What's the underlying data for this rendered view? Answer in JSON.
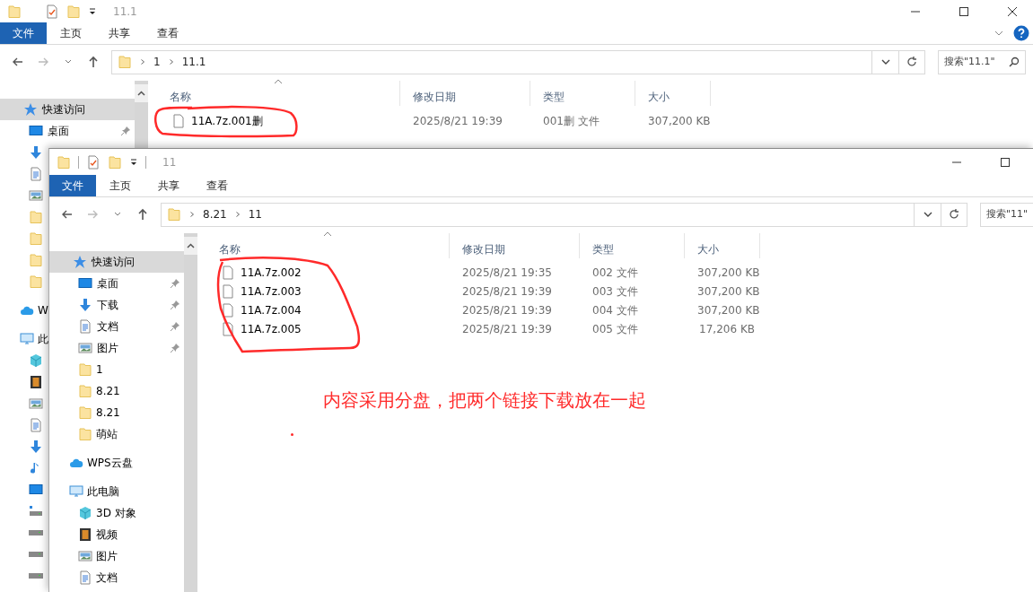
{
  "back_window": {
    "title": "11.1",
    "ribbon_tabs": [
      {
        "label": "文件",
        "selected": true
      },
      {
        "label": "主页",
        "selected": false
      },
      {
        "label": "共享",
        "selected": false
      },
      {
        "label": "查看",
        "selected": false
      }
    ],
    "breadcrumb": [
      "1",
      "11.1"
    ],
    "search": {
      "placeholder": "搜索\"11.1\""
    },
    "nav": [
      {
        "kind": "star",
        "label": "快速访问",
        "selected": true,
        "children": [
          {
            "kind": "desktop",
            "label": "桌面",
            "pinned": true
          },
          {
            "kind": "download"
          },
          {
            "kind": "doc"
          },
          {
            "kind": "picture"
          },
          {
            "kind": "folder"
          },
          {
            "kind": "folder"
          },
          {
            "kind": "folder"
          },
          {
            "kind": "folder"
          }
        ]
      },
      {
        "kind": "cloud",
        "label": "W",
        "selected": false
      },
      {
        "kind": "pc",
        "label": "此",
        "selected": false,
        "children": [
          {
            "kind": "cube"
          },
          {
            "kind": "video"
          },
          {
            "kind": "picture"
          },
          {
            "kind": "doc"
          },
          {
            "kind": "download"
          },
          {
            "kind": "music"
          },
          {
            "kind": "desktop"
          },
          {
            "kind": "drive-win"
          },
          {
            "kind": "drive"
          },
          {
            "kind": "drive"
          },
          {
            "kind": "drive"
          }
        ]
      }
    ],
    "columns": [
      "名称",
      "修改日期",
      "类型",
      "大小"
    ],
    "rows": [
      {
        "name": "11A.7z.001删",
        "modified": "2025/8/21 19:39",
        "type": "001删 文件",
        "size": "307,200 KB"
      }
    ]
  },
  "front_window": {
    "title": "11",
    "ribbon_tabs": [
      {
        "label": "文件",
        "selected": true
      },
      {
        "label": "主页",
        "selected": false
      },
      {
        "label": "共享",
        "selected": false
      },
      {
        "label": "查看",
        "selected": false
      }
    ],
    "breadcrumb": [
      "8.21",
      "11"
    ],
    "search": {
      "placeholder": "搜索\"11\""
    },
    "nav": [
      {
        "kind": "star",
        "label": "快速访问",
        "selected": true,
        "children": [
          {
            "kind": "desktop",
            "label": "桌面",
            "pinned": true
          },
          {
            "kind": "download",
            "label": "下载",
            "pinned": true
          },
          {
            "kind": "doc",
            "label": "文档",
            "pinned": true
          },
          {
            "kind": "picture",
            "label": "图片",
            "pinned": true
          },
          {
            "kind": "folder",
            "label": "1",
            "pinned": false
          },
          {
            "kind": "folder",
            "label": "8.21",
            "pinned": false
          },
          {
            "kind": "folder",
            "label": "8.21",
            "pinned": false
          },
          {
            "kind": "folder",
            "label": "萌站",
            "pinned": false
          }
        ]
      },
      {
        "kind": "cloud",
        "label": "WPS云盘",
        "selected": false
      },
      {
        "kind": "pc",
        "label": "此电脑",
        "selected": false,
        "children": [
          {
            "kind": "cube",
            "label": "3D 对象"
          },
          {
            "kind": "video",
            "label": "视频"
          },
          {
            "kind": "picture",
            "label": "图片"
          },
          {
            "kind": "doc",
            "label": "文档"
          }
        ]
      }
    ],
    "columns": [
      "名称",
      "修改日期",
      "类型",
      "大小"
    ],
    "rows": [
      {
        "name": "11A.7z.002",
        "modified": "2025/8/21 19:35",
        "type": "002 文件",
        "size": "307,200 KB"
      },
      {
        "name": "11A.7z.003",
        "modified": "2025/8/21 19:39",
        "type": "003 文件",
        "size": "307,200 KB"
      },
      {
        "name": "11A.7z.004",
        "modified": "2025/8/21 19:39",
        "type": "004 文件",
        "size": "307,200 KB"
      },
      {
        "name": "11A.7z.005",
        "modified": "2025/8/21 19:39",
        "type": "005 文件",
        "size": "17,206 KB"
      }
    ],
    "annotation": {
      "note": "内容采用分盘，把两个链接下载放在一起"
    }
  }
}
